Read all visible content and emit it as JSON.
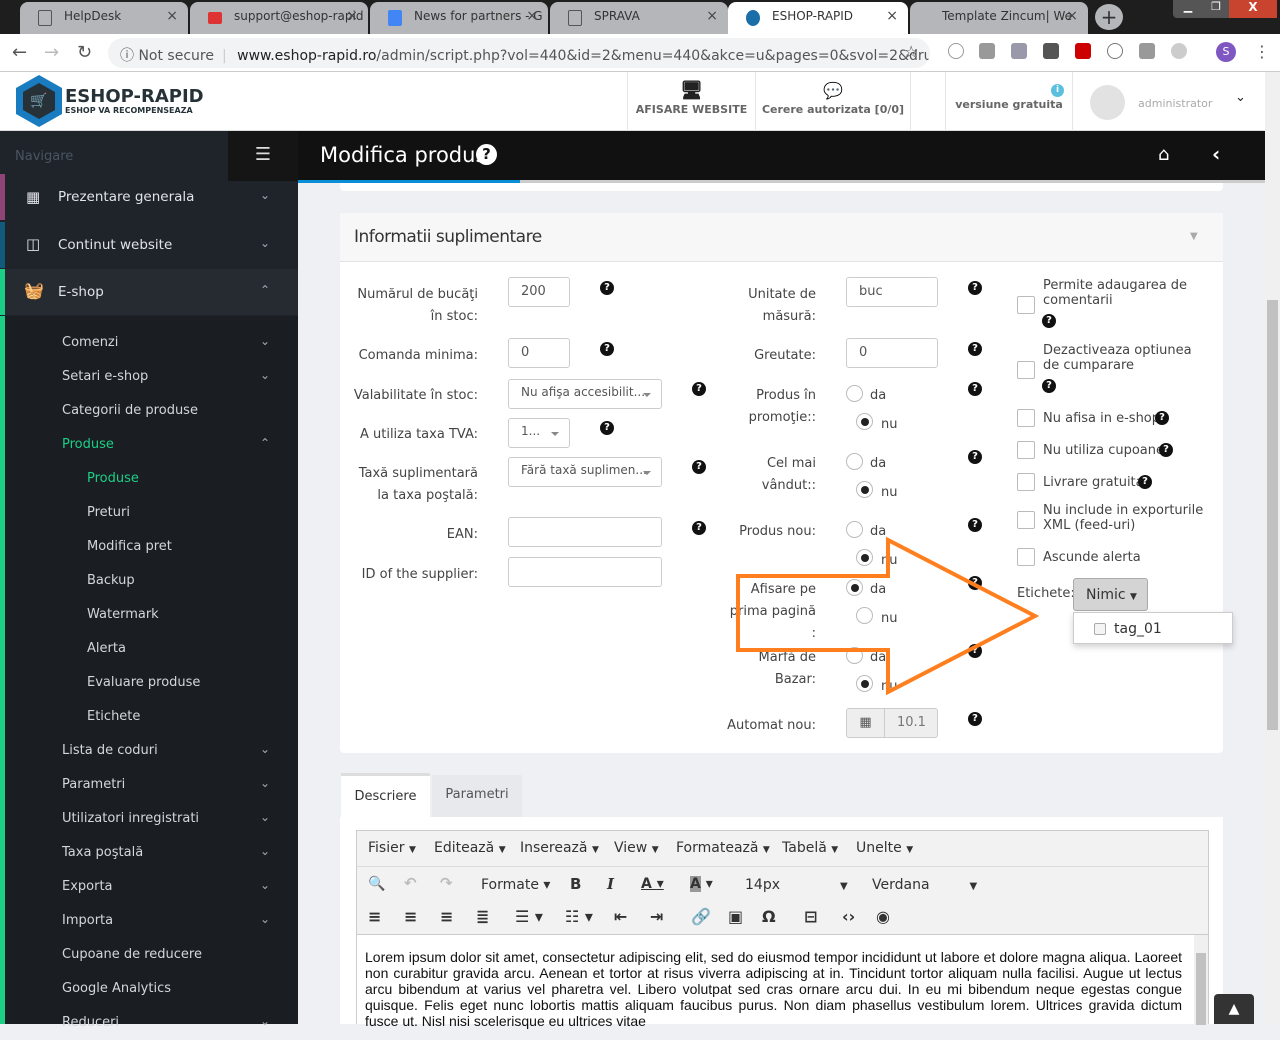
{
  "browser": {
    "tabs": [
      {
        "title": "HelpDesk"
      },
      {
        "title": "support@eshop-rapid"
      },
      {
        "title": "News for partners - G"
      },
      {
        "title": "SPRAVA"
      },
      {
        "title": "ESHOP-RAPID"
      },
      {
        "title": "Template Zincum| We"
      }
    ],
    "not_secure": "Not secure",
    "url_host": "www.eshop-rapid.ro",
    "url_path": "/admin/script.php?vol=440&id=2&menu=440&akce=u&pages=0&svol=2&druh=&i...",
    "profile_initial": "S"
  },
  "header": {
    "brand": "ESHOP-RAPID",
    "tagline": "ESHOP VA RECOMPENSEAZA",
    "show_site": "AFISARE WEBSITE",
    "requests": "Cerere autorizata [0/0]",
    "version": "versiune gratuita",
    "user": "administrator"
  },
  "sidebar": {
    "heading": "Navigare",
    "main": [
      {
        "label": "Prezentare generala",
        "color": "#8e4477"
      },
      {
        "label": "Continut website",
        "color": "#115a7c"
      },
      {
        "label": "E-shop",
        "color": "#1ccf86"
      }
    ],
    "sub": [
      "Comenzi",
      "Setari e-shop",
      "Categorii de produse",
      "Produse"
    ],
    "subsub": [
      "Produse",
      "Preturi",
      "Modifica pret",
      "Backup",
      "Watermark",
      "Alerta",
      "Evaluare produse",
      "Etichete"
    ],
    "more": [
      "Lista de coduri",
      "Parametri",
      "Utilizatori inregistrati",
      "Taxa poştală",
      "Exporta",
      "Importa",
      "Cupoane de reducere",
      "Google Analytics",
      "Reduceri"
    ]
  },
  "page": {
    "title": "Modifica produs",
    "panel_title": "Informatii suplimentare"
  },
  "form": {
    "stock_label": "Numărul de bucăţi în stoc:",
    "stock": "200",
    "min_label": "Comanda minima:",
    "min": "0",
    "avail_label": "Valabilitate în stoc:",
    "avail": "Nu afişa accesibilit...",
    "vat_label": "A utiliza taxa TVA:",
    "vat": "1...",
    "extra_label": "Taxă suplimentară la taxa poştală:",
    "extra": "Fără taxă suplimen...",
    "ean_label": "EAN:",
    "supplier_label": "ID of the supplier:",
    "unit_label": "Unitate de măsură:",
    "unit": "buc",
    "weight_label": "Greutate:",
    "weight": "0",
    "promo_label": "Produs în promoţie::",
    "best_label": "Cel mai vândut::",
    "new_label": "Produs nou:",
    "home_label": "Afisare pe prima pagină :",
    "bazar_label": "Marfă de Bazar:",
    "yes": "da",
    "no": "nu",
    "auto_label": "Automat nou:",
    "auto": "10.1",
    "checks": [
      "Permite adaugarea de comentarii",
      "Dezactiveaza optiunea de cumparare",
      "Nu afisa in e-shop",
      "Nu utiliza cupoane",
      "Livrare gratuita",
      "Nu include in exporturile XML (feed-uri)",
      "Ascunde alerta"
    ],
    "tags_label": "Etichete:",
    "tags_btn": "Nimic",
    "tag_option": "tag_01"
  },
  "tabs": [
    "Descriere",
    "Parametri"
  ],
  "editor": {
    "menus": [
      "Fisier",
      "Editează",
      "Inserează",
      "View",
      "Formatează",
      "Tabelă",
      "Unelte"
    ],
    "formats": "Formate",
    "size": "14px",
    "font": "Verdana",
    "text": "Lorem ipsum dolor sit amet, consectetur adipiscing elit, sed do eiusmod tempor incididunt ut labore et dolore magna aliqua. Laoreet non curabitur gravida arcu. Aenean et tortor at risus viverra adipiscing at in. Tincidunt tortor aliquam nulla facilisi. Augue ut lectus arcu bibendum at varius vel pharetra vel. Libero volutpat sed cras ornare arcu dui. In eu mi bibendum neque egestas congue quisque. Felis eget nunc lobortis mattis aliquam faucibus purus. Non diam phasellus vestibulum lorem. Ultrices gravida dictum fusce ut. Nisl nisi scelerisque eu ultrices vitae"
  },
  "colors": {
    "accent": "#0a8fd6",
    "highlight": "#ff7f1f",
    "active_green": "#1ccf86"
  }
}
